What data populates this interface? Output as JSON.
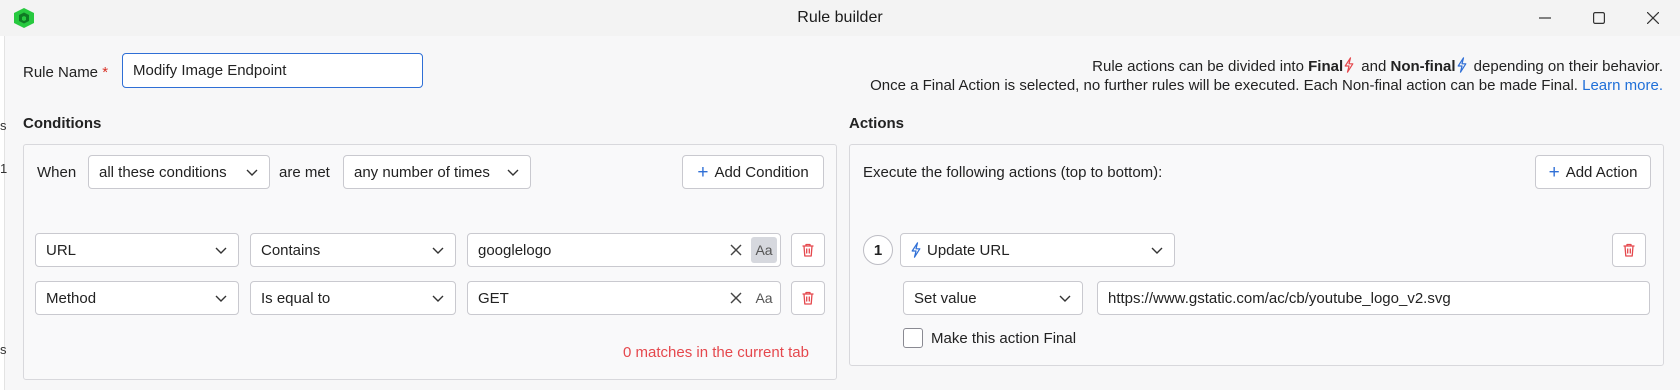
{
  "window": {
    "title": "Rule builder",
    "controls": [
      "minimize",
      "maximize",
      "close"
    ]
  },
  "left_strip": [
    "s",
    "1",
    "s"
  ],
  "rule_name": {
    "label": "Rule Name",
    "required_mark": "*",
    "value": "Modify Image Endpoint"
  },
  "info": {
    "line1_prefix": "Rule actions can be divided into ",
    "final": "Final",
    "and": " and ",
    "non_final": "Non-final",
    "line1_suffix": " depending on their behavior.",
    "line2": "Once a Final Action is selected, no further rules will be executed. Each Non-final action can be made Final. ",
    "learn_more": "Learn more.",
    "final_color": "#e5484d",
    "non_final_color": "#2f6fd6"
  },
  "conditions": {
    "title": "Conditions",
    "when_label": "When",
    "match_mode": "all these conditions",
    "are_met_label": "are met",
    "frequency": "any number of times",
    "add_label": "Add Condition",
    "rows": [
      {
        "field": "URL",
        "operator": "Contains",
        "value": "googlelogo",
        "case_sensitive_active": true
      },
      {
        "field": "Method",
        "operator": "Is equal to",
        "value": "GET",
        "case_sensitive_active": false
      }
    ],
    "case_glyph": "Aa",
    "matches_text": "0 matches in the current tab"
  },
  "actions": {
    "title": "Actions",
    "description": "Execute the following actions (top to bottom):",
    "add_label": "Add Action",
    "items": [
      {
        "number": "1",
        "type": "Update URL",
        "mode": "Set value",
        "value": "https://www.gstatic.com/ac/cb/youtube_logo_v2.svg",
        "make_final_label": "Make this action Final",
        "make_final_checked": false
      }
    ]
  },
  "colors": {
    "accent": "#2f6fd6",
    "danger": "#e5484d",
    "logo": "#27c93f"
  }
}
